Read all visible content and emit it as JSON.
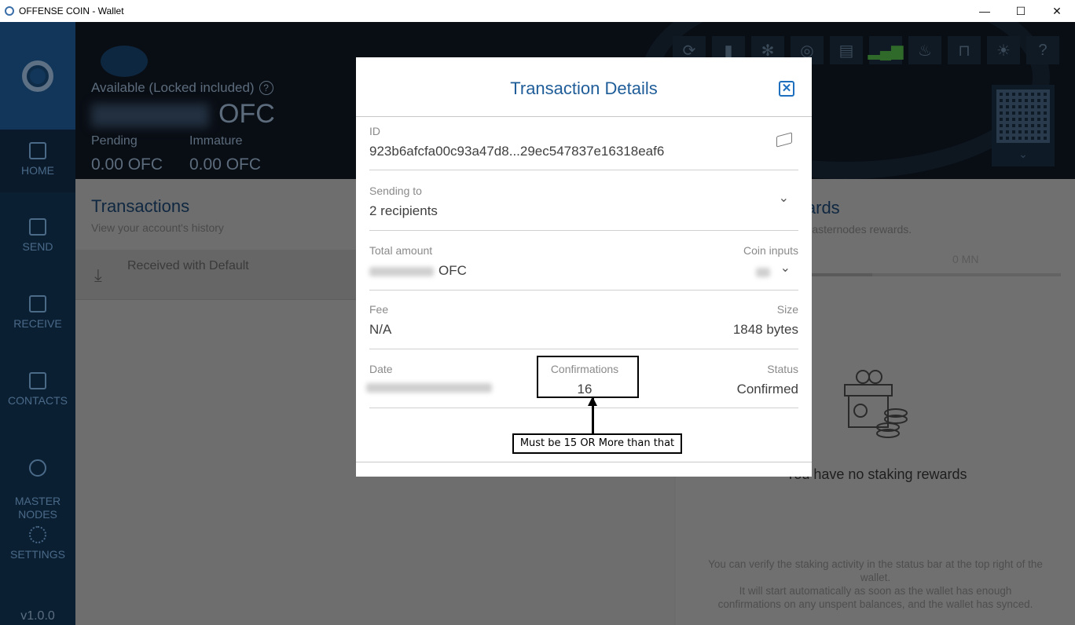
{
  "window": {
    "title": "OFFENSE COIN - Wallet",
    "minimize": "—",
    "maximize": "☐",
    "close": "✕"
  },
  "sidebar": {
    "items": [
      {
        "label": "HOME"
      },
      {
        "label": "SEND"
      },
      {
        "label": "RECEIVE"
      },
      {
        "label": "CONTACTS"
      },
      {
        "label": "MASTER\nNODES"
      },
      {
        "label": "SETTINGS"
      }
    ],
    "version": "v1.0.0"
  },
  "header": {
    "available_label": "Available (Locked included)",
    "help": "?",
    "currency": "OFC",
    "pending_label": "Pending",
    "pending_value": "0.00 OFC",
    "immature_label": "Immature",
    "immature_value": "0.00 OFC",
    "toolbar_icons": [
      "sync-icon",
      "database-icon",
      "snowflake-icon",
      "masternode-icon",
      "document-icon",
      "signal-icon",
      "fire-icon",
      "unlock-icon",
      "sun-icon",
      "help-icon"
    ],
    "qr_chevron": "⌄"
  },
  "transactions": {
    "title": "Transactions",
    "subtitle": "View your account's history",
    "row_label": "Received with Default"
  },
  "rewards": {
    "title": "wards",
    "subtitle": "d masternodes rewards.",
    "mn_count": "0 MN",
    "empty_title": "You have no staking rewards",
    "note": "You can verify the staking activity in the status bar at the top right of the wallet.\nIt will start automatically as soon as the wallet has enough confirmations on any unspent balances, and the wallet has synced."
  },
  "modal": {
    "title": "Transaction Details",
    "close": "✕",
    "id_label": "ID",
    "id_value": "923b6afcfa00c93a47d8...29ec547837e16318eaf6",
    "sending_label": "Sending to",
    "sending_value": "2 recipients",
    "total_label": "Total amount",
    "total_currency": "OFC",
    "inputs_label": "Coin inputs",
    "fee_label": "Fee",
    "fee_value": "N/A",
    "size_label": "Size",
    "size_value": "1848 bytes",
    "date_label": "Date",
    "confirmations_label": "Confirmations",
    "confirmations_value": "16",
    "status_label": "Status",
    "status_value": "Confirmed",
    "chevron": "⌄"
  },
  "annotation": {
    "text": "Must be 15 OR More than  that"
  }
}
